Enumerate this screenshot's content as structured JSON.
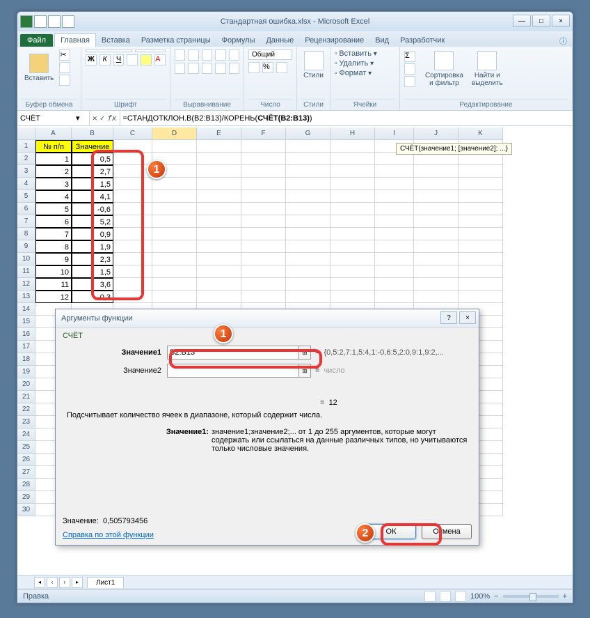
{
  "titlebar": {
    "filename": "Стандартная ошибка.xlsx",
    "appname": "Microsoft Excel"
  },
  "tabs": {
    "file": "Файл",
    "items": [
      "Главная",
      "Вставка",
      "Разметка страницы",
      "Формулы",
      "Данные",
      "Рецензирование",
      "Вид",
      "Разработчик"
    ],
    "active_index": 0
  },
  "ribbon": {
    "paste": "Вставить",
    "clipboard": "Буфер обмена",
    "font_group": "Шрифт",
    "align_group": "Выравнивание",
    "number_group": "Число",
    "number_format": "Общий",
    "styles": "Стили",
    "styles_btn": "Стили",
    "insert": "Вставить",
    "delete": "Удалить",
    "format": "Формат",
    "cells": "Ячейки",
    "sort": "Сортировка\nи фильтр",
    "find": "Найти и\nвыделить",
    "editing": "Редактирование",
    "bold": "Ж",
    "italic": "К",
    "underline": "Ч"
  },
  "formulabar": {
    "namebox": "СЧЁТ",
    "formula_pre": "=СТАНДОТКЛОН.В(B2:B13)/КОРЕНЬ(",
    "formula_bold": "СЧЁТ(B2:B13)",
    "formula_post": ")",
    "tooltip": "СЧЁТ(значение1; [значение2]; ...)"
  },
  "table": {
    "headers": [
      "№ п/п",
      "Значение"
    ],
    "rows": [
      [
        "1",
        "0,5"
      ],
      [
        "2",
        "2,7"
      ],
      [
        "3",
        "1,5"
      ],
      [
        "4",
        "4,1"
      ],
      [
        "5",
        "-0,6"
      ],
      [
        "6",
        "5,2"
      ],
      [
        "7",
        "0,9"
      ],
      [
        "8",
        "1,9"
      ],
      [
        "9",
        "2,3"
      ],
      [
        "10",
        "1,5"
      ],
      [
        "11",
        "3,6"
      ],
      [
        "12",
        "-0,3"
      ]
    ]
  },
  "dialog": {
    "title": "Аргументы функции",
    "funcname": "СЧЁТ",
    "arg1_label": "Значение1",
    "arg1_value": "B2:B13",
    "arg1_result": "{0,5:2,7:1,5:4,1:-0,6:5,2:0,9:1,9:2,...",
    "arg2_label": "Значение2",
    "arg2_value": "",
    "arg2_result": "число",
    "result_eq": "=",
    "result_val": "12",
    "description": "Подсчитывает количество ячеек в диапазоне, который содержит числа.",
    "argdesc_label": "Значение1:",
    "argdesc_text": "значение1;значение2;... от 1 до 255 аргументов, которые могут содержать или ссылаться на данные различных типов, но учитываются только числовые значения.",
    "value_label": "Значение:",
    "value_result": "0,505793456",
    "help_link": "Справка по этой функции",
    "ok": "ОК",
    "cancel": "Отмена"
  },
  "statusbar": {
    "mode": "Правка",
    "zoom": "100%"
  },
  "sheettabs": {
    "sheet1": "Лист1"
  },
  "markers": {
    "one": "1",
    "two": "2"
  }
}
